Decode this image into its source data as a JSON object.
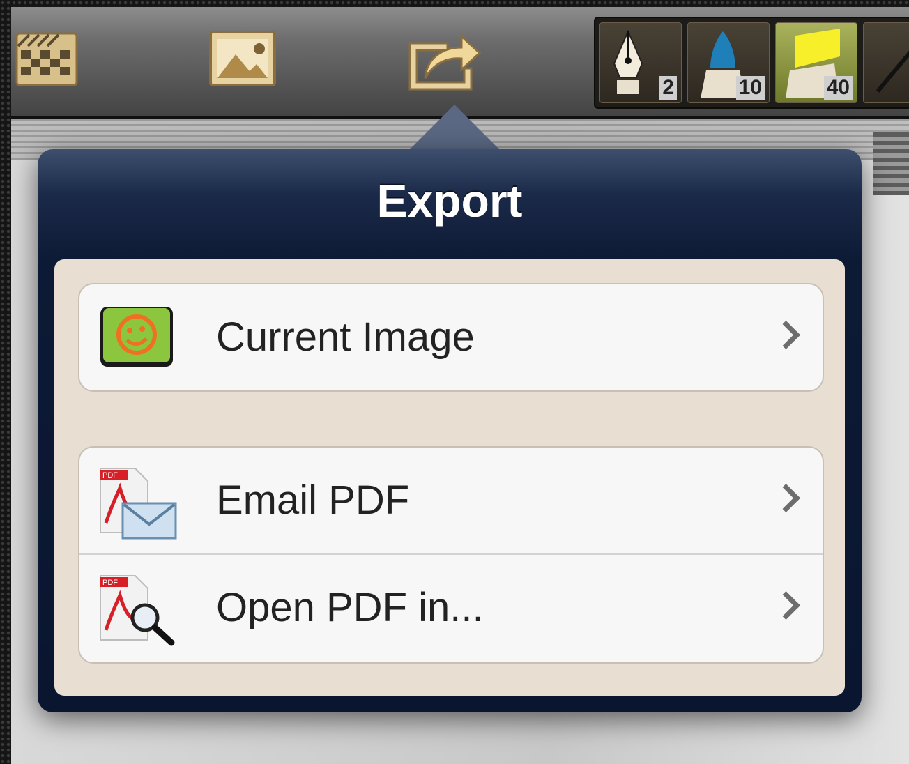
{
  "toolbar": {
    "icons": [
      "checker-icon",
      "picture-icon",
      "share-icon"
    ],
    "brushes": [
      {
        "name": "pen",
        "size": "2"
      },
      {
        "name": "marker",
        "size": "10"
      },
      {
        "name": "highlighter",
        "size": "40"
      },
      {
        "name": "pencil",
        "size": ""
      }
    ]
  },
  "popover": {
    "title": "Export",
    "items": [
      {
        "label": "Current Image",
        "icon": "app-image-icon"
      },
      {
        "label": "Email PDF",
        "icon": "pdf-email-icon"
      },
      {
        "label": "Open PDF in...",
        "icon": "pdf-search-icon"
      }
    ]
  },
  "colors": {
    "popover_header": "#0d1a35",
    "body_background": "#e8dfd2",
    "selected_brush": "#aab25c",
    "app_icon_green": "#8cc63f",
    "app_icon_orange": "#f07022",
    "pdf_red": "#d61f26"
  }
}
